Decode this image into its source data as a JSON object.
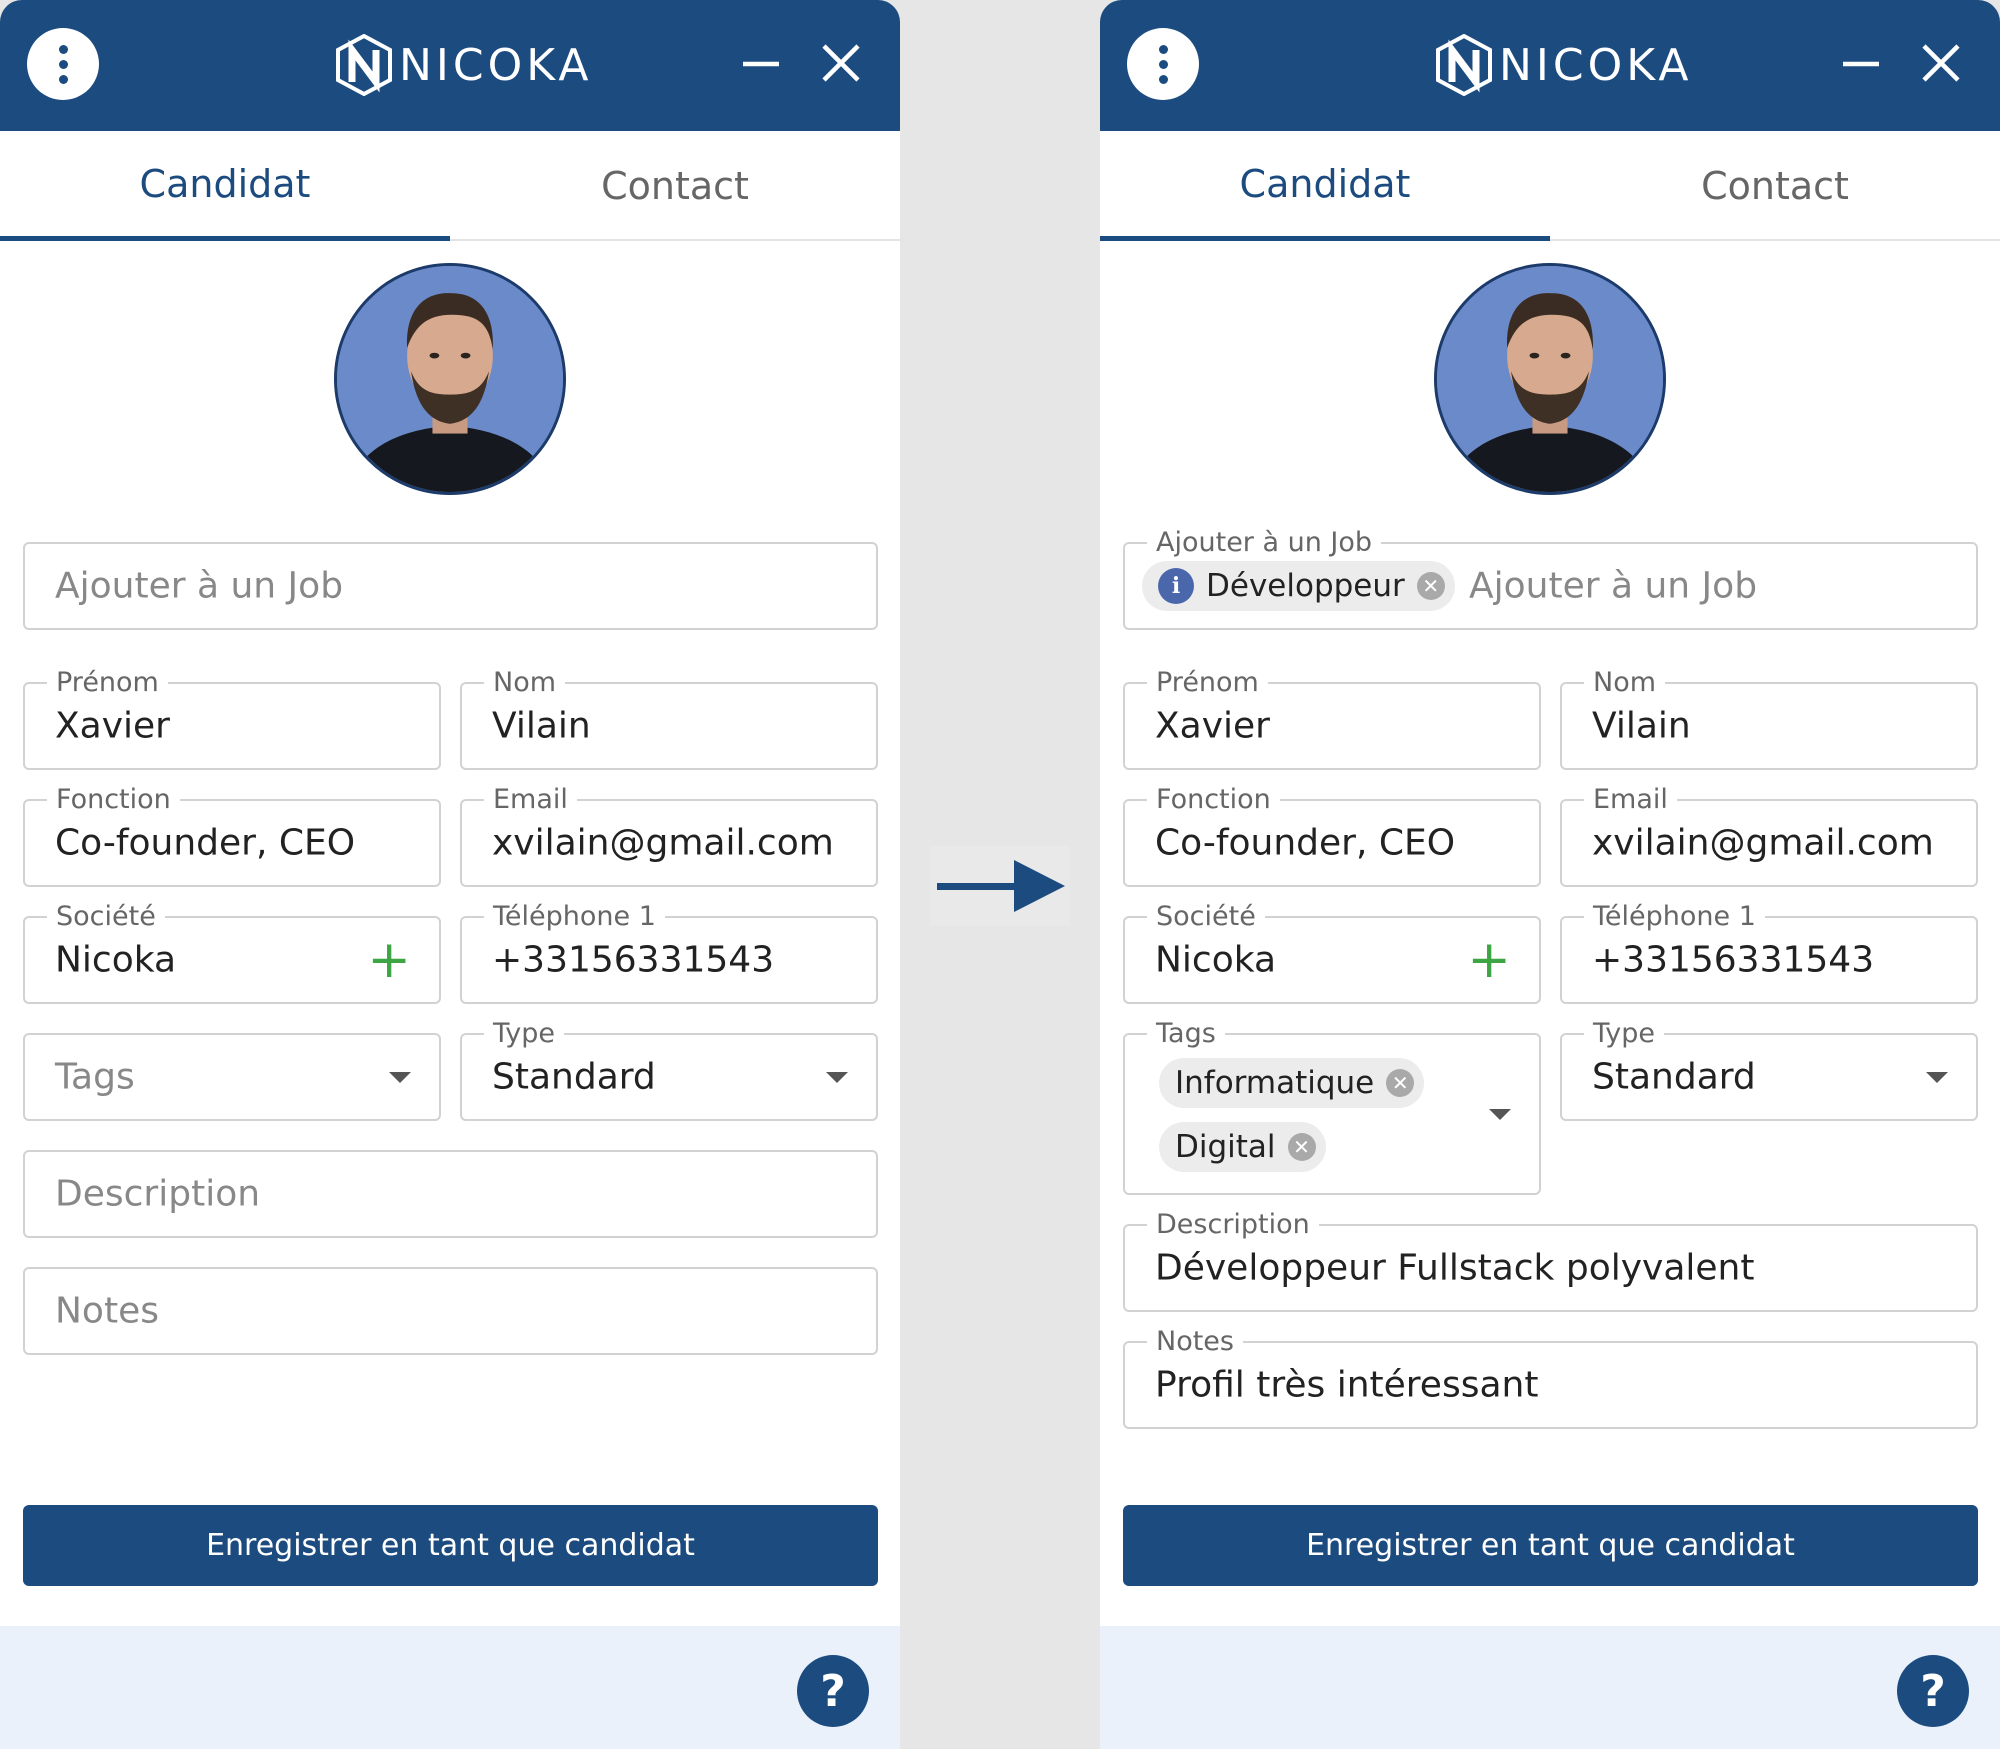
{
  "brand": {
    "name": "NICOKA",
    "primary_color": "#1c4b80",
    "accent_color": "#3ea545"
  },
  "tabs": [
    "Candidat",
    "Contact"
  ],
  "before": {
    "job": {
      "label": "Ajouter à un Job",
      "placeholder": "Ajouter à un Job",
      "chips": []
    },
    "prenom": {
      "label": "Prénom",
      "value": "Xavier"
    },
    "nom": {
      "label": "Nom",
      "value": "Vilain"
    },
    "fonction": {
      "label": "Fonction",
      "value": "Co-founder, CEO"
    },
    "email": {
      "label": "Email",
      "value": "xvilain@gmail.com"
    },
    "societe": {
      "label": "Société",
      "value": "Nicoka"
    },
    "telephone": {
      "label": "Téléphone 1",
      "value": "+33156331543"
    },
    "tags": {
      "label": "Tags",
      "placeholder": "Tags",
      "values": []
    },
    "type": {
      "label": "Type",
      "value": "Standard"
    },
    "description": {
      "label": "Description",
      "placeholder": "Description",
      "value": ""
    },
    "notes": {
      "label": "Notes",
      "placeholder": "Notes",
      "value": ""
    },
    "save_label": "Enregistrer en tant que candidat",
    "help_label": "?"
  },
  "after": {
    "job": {
      "label": "Ajouter à un Job",
      "placeholder": "Ajouter à un Job",
      "chips": [
        "Développeur"
      ]
    },
    "prenom": {
      "label": "Prénom",
      "value": "Xavier"
    },
    "nom": {
      "label": "Nom",
      "value": "Vilain"
    },
    "fonction": {
      "label": "Fonction",
      "value": "Co-founder, CEO"
    },
    "email": {
      "label": "Email",
      "value": "xvilain@gmail.com"
    },
    "societe": {
      "label": "Société",
      "value": "Nicoka"
    },
    "telephone": {
      "label": "Téléphone 1",
      "value": "+33156331543"
    },
    "tags": {
      "label": "Tags",
      "values": [
        "Informatique",
        "Digital"
      ]
    },
    "type": {
      "label": "Type",
      "value": "Standard"
    },
    "description": {
      "label": "Description",
      "value": "Développeur Fullstack polyvalent"
    },
    "notes": {
      "label": "Notes",
      "value": "Profil très intéressant"
    },
    "save_label": "Enregistrer en tant que candidat",
    "help_label": "?"
  },
  "icons": {
    "menu": "more-vertical-icon",
    "minimize": "minimize-icon",
    "close": "close-icon",
    "add": "plus-icon",
    "dropdown": "chevron-down-icon",
    "chip_remove": "remove-chip-icon",
    "info": "info-icon",
    "help": "help-icon",
    "transition": "arrow-right-icon"
  }
}
